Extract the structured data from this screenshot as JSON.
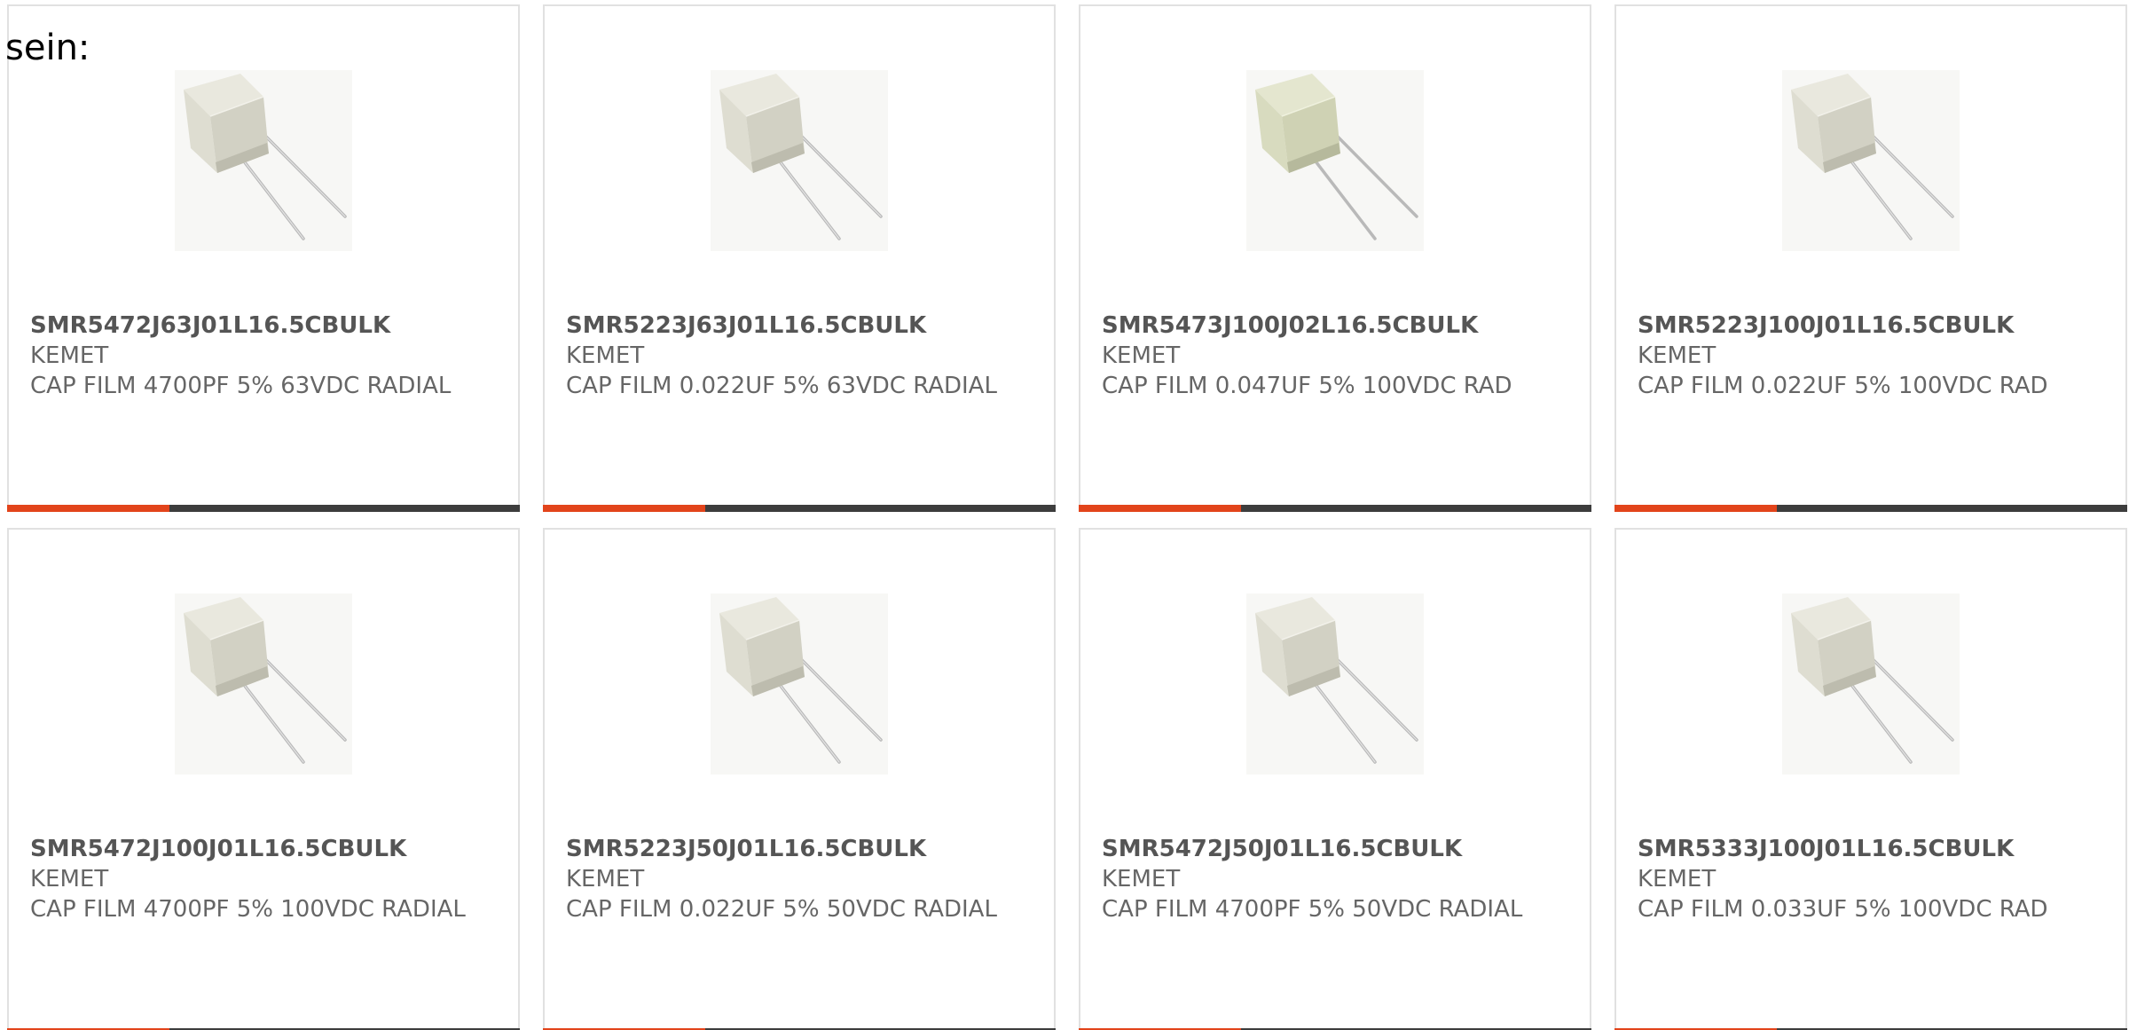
{
  "intro_text": "sein:",
  "colors": {
    "accent": "#e2441b",
    "bar_dark": "#3d3d3d",
    "border": "#e1e1e1",
    "text": "#666666"
  },
  "products": [
    {
      "part_number": "SMR5472J63J01L16.5CBULK",
      "manufacturer": "KEMET",
      "description": "CAP FILM 4700PF 5% 63VDC RADIAL",
      "image_icon": "film-capacitor-icon"
    },
    {
      "part_number": "SMR5223J63J01L16.5CBULK",
      "manufacturer": "KEMET",
      "description": "CAP FILM 0.022UF 5% 63VDC RADIAL",
      "image_icon": "film-capacitor-icon"
    },
    {
      "part_number": "SMR5473J100J02L16.5CBULK",
      "manufacturer": "KEMET",
      "description": "CAP FILM 0.047UF 5% 100VDC RAD",
      "image_icon": "film-capacitor-icon"
    },
    {
      "part_number": "SMR5223J100J01L16.5CBULK",
      "manufacturer": "KEMET",
      "description": "CAP FILM 0.022UF 5% 100VDC RAD",
      "image_icon": "film-capacitor-icon"
    },
    {
      "part_number": "SMR5472J100J01L16.5CBULK",
      "manufacturer": "KEMET",
      "description": "CAP FILM 4700PF 5% 100VDC RADIAL",
      "image_icon": "film-capacitor-icon"
    },
    {
      "part_number": "SMR5223J50J01L16.5CBULK",
      "manufacturer": "KEMET",
      "description": "CAP FILM 0.022UF 5% 50VDC RADIAL",
      "image_icon": "film-capacitor-icon"
    },
    {
      "part_number": "SMR5472J50J01L16.5CBULK",
      "manufacturer": "KEMET",
      "description": "CAP FILM 4700PF 5% 50VDC RADIAL",
      "image_icon": "film-capacitor-icon"
    },
    {
      "part_number": "SMR5333J100J01L16.5CBULK",
      "manufacturer": "KEMET",
      "description": "CAP FILM 0.033UF 5% 100VDC RAD",
      "image_icon": "film-capacitor-icon"
    }
  ]
}
